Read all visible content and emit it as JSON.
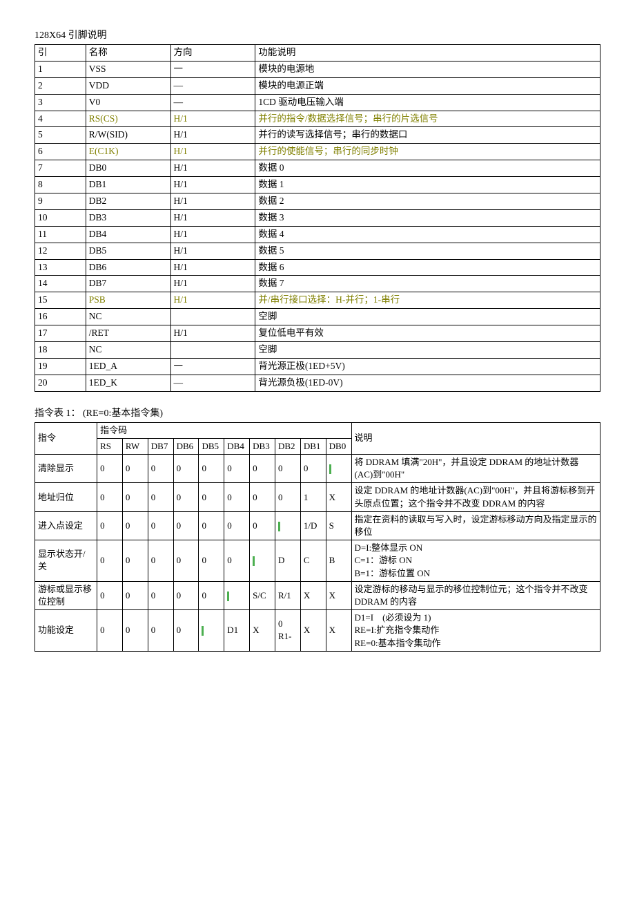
{
  "title1": "128X64 引脚说明",
  "pin_header": {
    "c1": "引",
    "c2": "名称",
    "c3": "方向",
    "c4": "功能说明"
  },
  "pins": [
    {
      "n": "1",
      "name": "VSS",
      "dir": "一",
      "desc": "模块的电源地"
    },
    {
      "n": "2",
      "name": "VDD",
      "dir": "—",
      "desc": "模块的电源正端"
    },
    {
      "n": "3",
      "name": "V0",
      "dir": "—",
      "desc": "1CD 驱动电压输入端"
    },
    {
      "n": "4",
      "name": "RS(CS)",
      "dir": "H/1",
      "desc": "并行的指令/数据选择信号；串行的片选信号",
      "olive": true
    },
    {
      "n": "5",
      "name": "R/W(SID)",
      "dir": "H/1",
      "desc": "并行的读写选择信号；串行的数据口"
    },
    {
      "n": "6",
      "name": "E(C1K)",
      "dir": "H/1",
      "desc": "并行的使能信号；串行的同步时钟",
      "olive": true
    },
    {
      "n": "7",
      "name": "DB0",
      "dir": "H/1",
      "desc": "数据 0"
    },
    {
      "n": "8",
      "name": "DB1",
      "dir": "H/1",
      "desc": "数据 1"
    },
    {
      "n": "9",
      "name": "DB2",
      "dir": "H/1",
      "desc": "数据 2"
    },
    {
      "n": "10",
      "name": "DB3",
      "dir": "H/1",
      "desc": "数据 3"
    },
    {
      "n": "11",
      "name": "DB4",
      "dir": "H/1",
      "desc": "数据 4"
    },
    {
      "n": "12",
      "name": "DB5",
      "dir": "H/1",
      "desc": "数据 5"
    },
    {
      "n": "13",
      "name": "DB6",
      "dir": "H/1",
      "desc": "数据 6"
    },
    {
      "n": "14",
      "name": "DB7",
      "dir": "H/1",
      "desc": "数据 7"
    },
    {
      "n": "15",
      "name": "PSB",
      "dir": "H/1",
      "desc": "并/串行接口选择：H-并行；1-串行",
      "olive": true
    },
    {
      "n": "16",
      "name": "NC",
      "dir": "",
      "desc": "空脚"
    },
    {
      "n": "17",
      "name": "/RET",
      "dir": "H/1",
      "desc": "复位低电平有效"
    },
    {
      "n": "18",
      "name": "NC",
      "dir": "",
      "desc": "空脚"
    },
    {
      "n": "19",
      "name": "1ED_A",
      "dir": "一",
      "desc": "背光源正极(1ED+5V)"
    },
    {
      "n": "20",
      "name": "1ED_K",
      "dir": "—",
      "desc": "背光源负极(1ED-0V)"
    }
  ],
  "title2": "指令表 1： (RE=0:基本指令集)",
  "instr_header": {
    "code_group": "指令码",
    "instr": "指令",
    "rs": "RS",
    "rw": "RW",
    "db7": "DB7",
    "db6": "DB6",
    "db5": "DB5",
    "db4": "DB4",
    "db3": "DB3",
    "db2": "DB2",
    "db1": "DB1",
    "db0": "DB0",
    "desc": "说明"
  },
  "instructions": [
    {
      "name": "清除显示",
      "bits": [
        "0",
        "0",
        "0",
        "0",
        "0",
        "0",
        "0",
        "0",
        "0",
        "|"
      ],
      "db0_green": true,
      "desc": "将 DDRAM 填满\"20H\"，并且设定 DDRAM 的地址计数器(AC)到\"00H\""
    },
    {
      "name": "地址归位",
      "bits": [
        "0",
        "0",
        "0",
        "0",
        "0",
        "0",
        "0",
        "0",
        "1",
        "X"
      ],
      "desc": "设定 DDRAM 的地址计数器(AC)到\"00H\"，并且将游标移到开头原点位置；这个指令并不改变 DDRAM 的内容"
    },
    {
      "name": "进入点设定",
      "bits": [
        "0",
        "0",
        "0",
        "0",
        "0",
        "0",
        "0",
        "|",
        "1/D",
        "S"
      ],
      "db2_green": true,
      "desc": "指定在资料的读取与写入时，设定游标移动方向及指定显示的移位"
    },
    {
      "name": "显示状态开/关",
      "bits": [
        "0",
        "0",
        "0",
        "0",
        "0",
        "0",
        "|",
        "D",
        "C",
        "B"
      ],
      "db3_green": true,
      "desc": "D=I:整体显示 ON\nC=1：游标 ON\nB=1：游标位置 ON"
    },
    {
      "name": "游标或显示移位控制",
      "bits": [
        "0",
        "0",
        "0",
        "0",
        "0",
        "|",
        "S/C",
        "R/1",
        "X",
        "X"
      ],
      "db4_green": true,
      "desc": "设定游标的移动与显示的移位控制位元；这个指令并不改变 DDRAM 的内容"
    },
    {
      "name": "功能设定",
      "bits": [
        "0",
        "0",
        "0",
        "0",
        "|",
        "D1",
        "X",
        "0 R1-",
        "X",
        "X"
      ],
      "db5_green": true,
      "desc": "D1=I　(必须设为 1)\nRE=I:扩充指令集动作\nRE=0:基本指令集动作"
    }
  ]
}
